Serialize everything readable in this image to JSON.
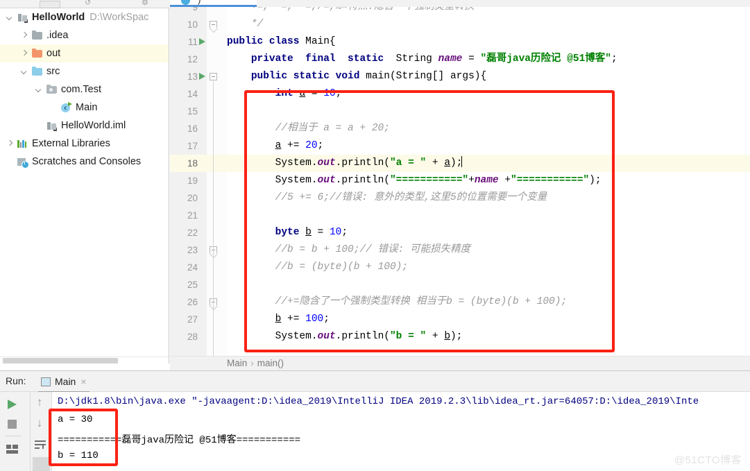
{
  "toolbar": {
    "icons": [
      "rect-button-icon",
      "undo-arrow-icon",
      "settings-gear-icon",
      "download-icon",
      "vcs-icon"
    ]
  },
  "editor_tab": {
    "label": ")",
    "icon": "java-class-tab-icon"
  },
  "project_panel": {
    "tree": [
      {
        "indent": 0,
        "arrow": "down",
        "icon": "module-icon",
        "label": "HelloWorld",
        "bold": true,
        "path": "D:\\WorkSpac",
        "selected": false
      },
      {
        "indent": 1,
        "arrow": "right",
        "icon": "folder-grey-icon",
        "label": ".idea",
        "bold": false,
        "path": "",
        "selected": false
      },
      {
        "indent": 1,
        "arrow": "right",
        "icon": "folder-orange-icon",
        "label": "out",
        "bold": false,
        "path": "",
        "selected": true
      },
      {
        "indent": 1,
        "arrow": "down",
        "icon": "folder-blue-icon",
        "label": "src",
        "bold": false,
        "path": "",
        "selected": false
      },
      {
        "indent": 2,
        "arrow": "down",
        "icon": "package-icon",
        "label": "com.Test",
        "bold": false,
        "path": "",
        "selected": false
      },
      {
        "indent": 3,
        "arrow": "none",
        "icon": "java-class-icon",
        "label": "Main",
        "bold": false,
        "path": "",
        "selected": false
      },
      {
        "indent": 2,
        "arrow": "none",
        "icon": "module-icon",
        "label": "HelloWorld.iml",
        "bold": false,
        "path": "",
        "selected": false
      },
      {
        "indent": 0,
        "arrow": "right",
        "icon": "libraries-icon",
        "label": "External Libraries",
        "bold": false,
        "path": "",
        "selected": false
      },
      {
        "indent": 0,
        "arrow": "none",
        "icon": "scratches-icon",
        "label": "Scratches and Consoles",
        "bold": false,
        "path": "",
        "selected": false
      }
    ]
  },
  "editor": {
    "first_visible_line": 9,
    "current_line": 18,
    "lines": [
      {
        "n": 9,
        "run": false,
        "fold": "none",
        "tokens": [
          {
            "t": "    ",
            "c": "plain"
          },
          {
            "t": "+=, -=, *=,/=,%=特点:隐含一个强制类型转换",
            "c": "cmt"
          }
        ]
      },
      {
        "n": 10,
        "run": false,
        "fold": "end",
        "tokens": [
          {
            "t": "    ",
            "c": "plain"
          },
          {
            "t": "*/",
            "c": "cmt"
          }
        ]
      },
      {
        "n": 11,
        "run": true,
        "fold": "none",
        "tokens": [
          {
            "t": "public class ",
            "c": "kw"
          },
          {
            "t": "Main{",
            "c": "plain"
          }
        ]
      },
      {
        "n": 12,
        "run": false,
        "fold": "none",
        "tokens": [
          {
            "t": "    ",
            "c": "plain"
          },
          {
            "t": "private  final  static  ",
            "c": "kw"
          },
          {
            "t": "String ",
            "c": "plain"
          },
          {
            "t": "name",
            "c": "fld"
          },
          {
            "t": " = ",
            "c": "plain"
          },
          {
            "t": "\"磊哥java历险记 @51博客\"",
            "c": "str"
          },
          {
            "t": ";",
            "c": "plain"
          }
        ]
      },
      {
        "n": 13,
        "run": true,
        "fold": "start",
        "tokens": [
          {
            "t": "    ",
            "c": "plain"
          },
          {
            "t": "public static void ",
            "c": "kw"
          },
          {
            "t": "main(String[] args){",
            "c": "plain"
          }
        ]
      },
      {
        "n": 14,
        "run": false,
        "fold": "none",
        "tokens": [
          {
            "t": "        ",
            "c": "plain"
          },
          {
            "t": "int ",
            "c": "kw"
          },
          {
            "t": "a",
            "c": "plain-und"
          },
          {
            "t": " = ",
            "c": "plain"
          },
          {
            "t": "10",
            "c": "num-lit"
          },
          {
            "t": ";",
            "c": "plain"
          }
        ]
      },
      {
        "n": 15,
        "run": false,
        "fold": "none",
        "tokens": []
      },
      {
        "n": 16,
        "run": false,
        "fold": "none",
        "tokens": [
          {
            "t": "        ",
            "c": "plain"
          },
          {
            "t": "//相当于 a = a + 20;",
            "c": "cmt"
          }
        ]
      },
      {
        "n": 17,
        "run": false,
        "fold": "none",
        "tokens": [
          {
            "t": "        ",
            "c": "plain"
          },
          {
            "t": "a",
            "c": "plain-und"
          },
          {
            "t": " += ",
            "c": "plain"
          },
          {
            "t": "20",
            "c": "num-lit"
          },
          {
            "t": ";",
            "c": "plain"
          }
        ]
      },
      {
        "n": 18,
        "run": false,
        "fold": "none",
        "caret": true,
        "tokens": [
          {
            "t": "        ",
            "c": "plain"
          },
          {
            "t": "System.",
            "c": "plain"
          },
          {
            "t": "out",
            "c": "fld"
          },
          {
            "t": ".println(",
            "c": "plain"
          },
          {
            "t": "\"a = \"",
            "c": "str"
          },
          {
            "t": " + ",
            "c": "plain"
          },
          {
            "t": "a",
            "c": "plain-und"
          },
          {
            "t": ");",
            "c": "plain"
          }
        ]
      },
      {
        "n": 19,
        "run": false,
        "fold": "none",
        "tokens": [
          {
            "t": "        ",
            "c": "plain"
          },
          {
            "t": "System.",
            "c": "plain"
          },
          {
            "t": "out",
            "c": "fld"
          },
          {
            "t": ".println(",
            "c": "plain"
          },
          {
            "t": "\"===========\"",
            "c": "str"
          },
          {
            "t": "+",
            "c": "plain"
          },
          {
            "t": "name",
            "c": "fld"
          },
          {
            "t": " +",
            "c": "plain"
          },
          {
            "t": "\"===========\"",
            "c": "str"
          },
          {
            "t": ");",
            "c": "plain"
          }
        ]
      },
      {
        "n": 20,
        "run": false,
        "fold": "none",
        "tokens": [
          {
            "t": "        ",
            "c": "plain"
          },
          {
            "t": "//5 += 6;//错误: 意外的类型,这里5的位置需要一个变量",
            "c": "cmt"
          }
        ]
      },
      {
        "n": 21,
        "run": false,
        "fold": "none",
        "tokens": []
      },
      {
        "n": 22,
        "run": false,
        "fold": "none",
        "tokens": [
          {
            "t": "        ",
            "c": "plain"
          },
          {
            "t": "byte ",
            "c": "kw"
          },
          {
            "t": "b",
            "c": "plain-und"
          },
          {
            "t": " = ",
            "c": "plain"
          },
          {
            "t": "10",
            "c": "num-lit"
          },
          {
            "t": ";",
            "c": "plain"
          }
        ]
      },
      {
        "n": 23,
        "run": false,
        "fold": "end",
        "tokens": [
          {
            "t": "        ",
            "c": "plain"
          },
          {
            "t": "//b = b + 100;// 错误: 可能损失精度",
            "c": "cmt"
          }
        ]
      },
      {
        "n": 24,
        "run": false,
        "fold": "none",
        "tokens": [
          {
            "t": "        ",
            "c": "plain"
          },
          {
            "t": "//b = (byte)(b + 100);",
            "c": "cmt"
          }
        ]
      },
      {
        "n": 25,
        "run": false,
        "fold": "none",
        "tokens": []
      },
      {
        "n": 26,
        "run": false,
        "fold": "end",
        "tokens": [
          {
            "t": "        ",
            "c": "plain"
          },
          {
            "t": "//+=隐含了一个强制类型转换 相当于b = (byte)(b + 100);",
            "c": "cmt"
          }
        ]
      },
      {
        "n": 27,
        "run": false,
        "fold": "none",
        "tokens": [
          {
            "t": "        ",
            "c": "plain"
          },
          {
            "t": "b",
            "c": "plain-und"
          },
          {
            "t": " += ",
            "c": "plain"
          },
          {
            "t": "100",
            "c": "num-lit"
          },
          {
            "t": ";",
            "c": "plain"
          }
        ]
      },
      {
        "n": 28,
        "run": false,
        "fold": "none",
        "tokens": [
          {
            "t": "        ",
            "c": "plain"
          },
          {
            "t": "System.",
            "c": "plain"
          },
          {
            "t": "out",
            "c": "fld"
          },
          {
            "t": ".println(",
            "c": "plain"
          },
          {
            "t": "\"b = \"",
            "c": "str"
          },
          {
            "t": " + ",
            "c": "plain"
          },
          {
            "t": "b",
            "c": "plain-und"
          },
          {
            "t": ");",
            "c": "plain"
          }
        ]
      }
    ]
  },
  "breadcrumb": {
    "parts": [
      "Main",
      "main()"
    ],
    "separator": "›"
  },
  "run_window": {
    "title": "Run:",
    "tab_name": "Main",
    "close_label": "×",
    "buttons": [
      {
        "name": "rerun-button",
        "icon": "play-icon"
      },
      {
        "name": "stop-button",
        "icon": "stop-icon"
      },
      {
        "name": "layout-button",
        "icon": "layout-icon"
      },
      {
        "name": "scroll-up-button",
        "icon": "arrow-up-icon",
        "glyph": "↑"
      },
      {
        "name": "scroll-down-button",
        "icon": "arrow-down-icon",
        "glyph": "↓"
      },
      {
        "name": "soft-wrap-button",
        "icon": "soft-wrap-icon"
      }
    ],
    "console_lines": [
      {
        "text": "D:\\jdk1.8\\bin\\java.exe \"-javaagent:D:\\idea_2019\\IntelliJ IDEA 2019.2.3\\lib\\idea_rt.jar=64057:D:\\idea_2019\\Inte",
        "kind": "command"
      },
      {
        "text": "a = 30",
        "kind": "stdout"
      },
      {
        "text": "===========磊哥java历险记 @51博客===========",
        "kind": "stdout"
      },
      {
        "text": "b = 110",
        "kind": "stdout"
      }
    ]
  },
  "annotations": {
    "editor_box_color": "#fb2113",
    "console_box_color": "#fb2113"
  },
  "watermark": {
    "text": "@51CTO博客"
  }
}
